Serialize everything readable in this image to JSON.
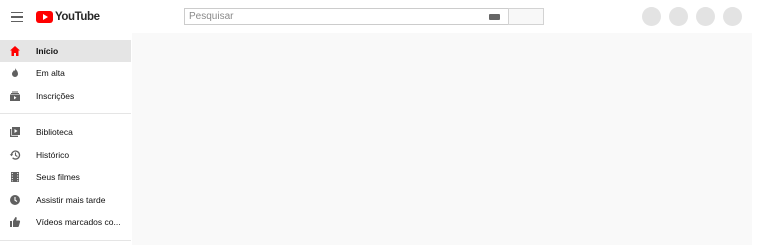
{
  "header": {
    "logo_text": "YouTube",
    "search": {
      "placeholder": "Pesquisar",
      "value": ""
    }
  },
  "sidebar": {
    "items": [
      {
        "label": "Início",
        "icon": "home-icon",
        "active": true
      },
      {
        "label": "Em alta",
        "icon": "flame-icon",
        "active": false
      },
      {
        "label": "Inscrições",
        "icon": "subscriptions-icon",
        "active": false
      },
      {
        "label": "Biblioteca",
        "icon": "library-icon",
        "active": false
      },
      {
        "label": "Histórico",
        "icon": "history-icon",
        "active": false
      },
      {
        "label": "Seus filmes",
        "icon": "film-icon",
        "active": false
      },
      {
        "label": "Assistir mais tarde",
        "icon": "clock-icon",
        "active": false
      },
      {
        "label": "Vídeos marcados co...",
        "icon": "thumbs-up-icon",
        "active": false
      }
    ]
  },
  "colors": {
    "brand": "#ff0000",
    "active_item_bg": "#e5e5e5",
    "page_bg": "#f9f9f9"
  }
}
